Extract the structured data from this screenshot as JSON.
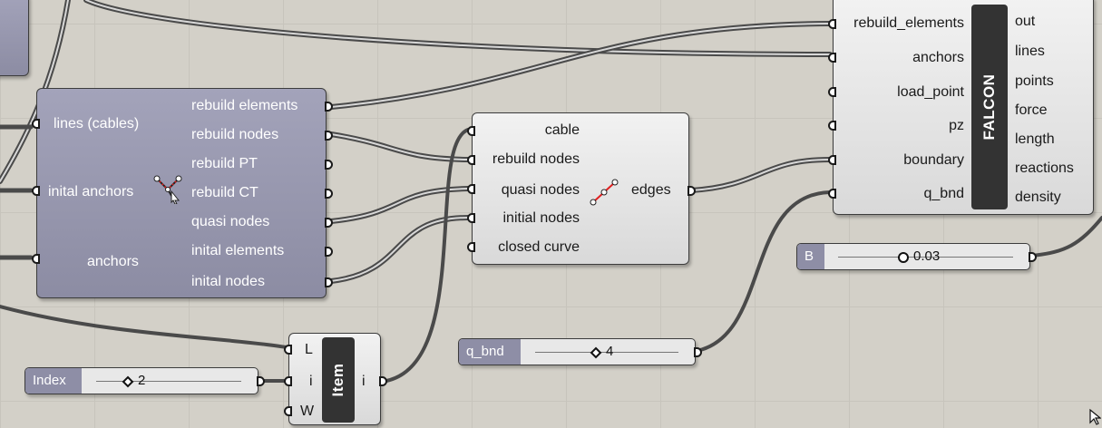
{
  "explode_component": {
    "inputs": [
      "lines (cables)",
      "inital anchors",
      "anchors"
    ],
    "outputs": [
      "rebuild elements",
      "rebuild nodes",
      "rebuild PT",
      "rebuild CT",
      "quasi nodes",
      "inital elements",
      "inital nodes"
    ],
    "icon": "explode-nodes-icon"
  },
  "edges_component": {
    "inputs": [
      "cable",
      "rebuild nodes",
      "quasi nodes",
      "initial nodes",
      "closed curve"
    ],
    "outputs": [
      "edges"
    ],
    "icon": "polyline-edges-icon"
  },
  "falcon_component": {
    "title": "FALCON",
    "inputs": [
      "rebuild_elements",
      "anchors",
      "load_point",
      "pz",
      "boundary",
      "q_bnd"
    ],
    "outputs": [
      "out",
      "lines",
      "points",
      "force",
      "length",
      "reactions",
      "density"
    ]
  },
  "item_component": {
    "title": "Item",
    "inputs": [
      "L",
      "i",
      "W"
    ],
    "outputs": [
      "i"
    ]
  },
  "sliders": {
    "b": {
      "name": "B",
      "value": "0.03",
      "position": 0.35
    },
    "q_bnd": {
      "name": "q_bnd",
      "value": "4",
      "position": 0.5
    },
    "index": {
      "name": "Index",
      "value": "2",
      "position": 0.25
    }
  },
  "colors": {
    "canvas": "#d3d0c8",
    "component_dark": "#9a9ab0",
    "component_light": "#e6e6e6",
    "wire": "#4a4a4a"
  }
}
